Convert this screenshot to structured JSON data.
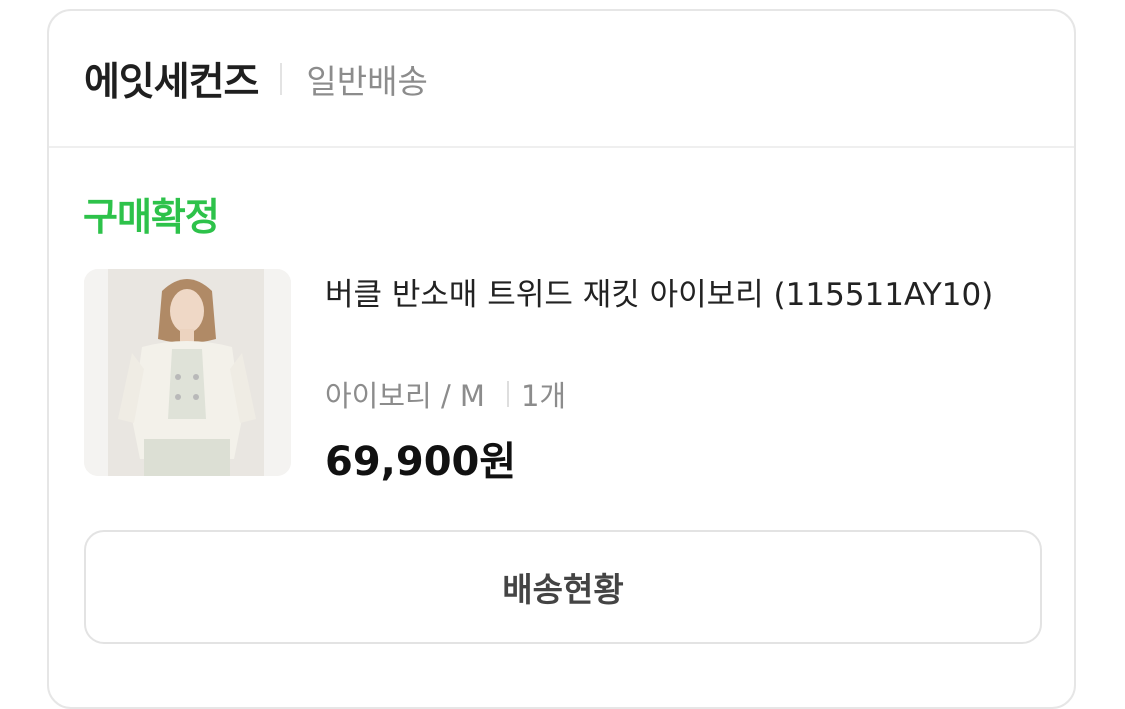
{
  "seller": {
    "name": "에잇세컨즈",
    "shipping_type": "일반배송"
  },
  "order": {
    "status": "구매확정",
    "accent_color": "#2dc24a"
  },
  "product": {
    "name": "버클 반소매 트위드 재킷 아이보리 (115511AY10)",
    "option": "아이보리 / M",
    "quantity": "1개",
    "price": "69,900원",
    "image_icon": "product-photo"
  },
  "actions": {
    "track_label": "배송현황"
  }
}
